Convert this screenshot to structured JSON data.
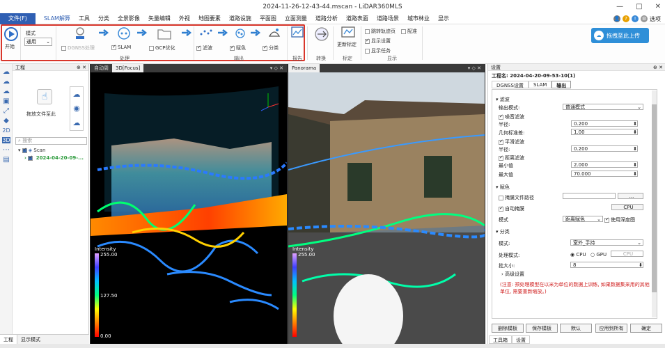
{
  "window": {
    "title": "2024-11-26-12-43-44.mscan - LiDAR360MLS",
    "min": "—",
    "max": "□",
    "close": "✕"
  },
  "menu": {
    "items": [
      "文件(F)",
      "SLAM解算",
      "工具",
      "分类",
      "全景影像",
      "矢量编辑",
      "外视",
      "地图要素",
      "道路设施",
      "平面图",
      "立面测量",
      "道路分析",
      "道路表面",
      "道路场景",
      "城市林业",
      "显示"
    ],
    "options": "选项"
  },
  "ribbon": {
    "start_label": "开始",
    "mode_label": "模式",
    "mode_value": "通用",
    "dgnss_label": "DGNSS处理",
    "slam_label": "SLAM",
    "gcp_label": "GCP优化",
    "process_group": "处理",
    "filter_label": "滤波",
    "colorize_label": "赋色",
    "classify_label": "分类",
    "output_group": "输出",
    "report_group": "报告",
    "convert_group": "转换",
    "update_label": "更新标定",
    "calib_group": "标定",
    "jump_label": "跳转轨迹页",
    "config_label": "配准",
    "show_settings": "显示设置",
    "show_tasks": "显示任务",
    "display_group": "显示",
    "upload_label": "拖拽至此上传"
  },
  "project": {
    "title": "工程",
    "drop_label": "拖放文件至此",
    "search_placeholder": "搜索",
    "tree_root": "Scan",
    "tree_child": "2024-04-20-09-..."
  },
  "views": {
    "tab_auto": "自动周",
    "tab_3d": "3D[Focus]",
    "tab_pano": "Panorama",
    "legend_title": "Intensity",
    "legend_max": "255.00",
    "legend_mid": "127.50",
    "legend_min": "0.00"
  },
  "settings": {
    "title": "设置",
    "project_name": "工程名: 2024-04-20-09-53-10(1)",
    "tabs": [
      "DGNSS设置",
      "SLAM",
      "输出"
    ],
    "filter_section": "滤波",
    "output_mode_label": "输出模式:",
    "output_mode_value": "普通模式",
    "noise_filter": "噪音滤波",
    "radius_label": "半径:",
    "radius_value": "0.200",
    "geom_std_label": "几何标准差:",
    "geom_std_value": "1.00",
    "smooth_filter": "平滑滤波",
    "radius2_value": "0.200",
    "dist_filter": "距离滤波",
    "min_label": "最小值",
    "min_value": "2.000",
    "max_label": "最大值",
    "max_value": "70.000",
    "color_section": "赋色",
    "mask_path": "掩膜文件路径",
    "browse": "...",
    "auto_mask": "自动掩膜",
    "cpu": "CPU",
    "mode_label": "模式",
    "color_mode_value": "距离赋色",
    "use_depth": "使用深度图",
    "classify_section": "分类",
    "cls_mode_label": "模式:",
    "cls_mode_value": "室外_手持",
    "proc_mode_label": "处理模式:",
    "cpu_radio": "CPU",
    "gpu_radio": "GPU",
    "gpu_select": "CPU",
    "batch_label": "批大小:",
    "batch_value": "8",
    "advanced": "高级设置",
    "note": "(注意: 预处理模型在以米为单位的数据上训练, 如果数据集采用的其他单位, 需要重新缩放。)",
    "buttons": [
      "删除模板",
      "保存模板",
      "默认",
      "应用到所有",
      "确定"
    ],
    "bottom_tabs": [
      "工具箱",
      "设置"
    ]
  },
  "status": {
    "tabs": [
      "工程",
      "显示模式"
    ]
  }
}
